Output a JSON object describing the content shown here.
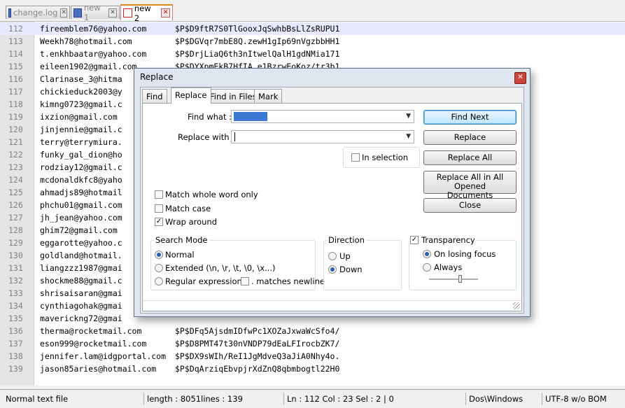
{
  "tabs": [
    {
      "label": "change.log",
      "icon": "file-saved-icon"
    },
    {
      "label": "new  1",
      "icon": "file-saved-icon"
    },
    {
      "label": "new  2",
      "icon": "file-unsaved-icon",
      "active": true
    }
  ],
  "lines": [
    {
      "n": "112",
      "email": "fireemblem76@yahoo.com",
      "pw": "$P$D9ftR7S0TlGooxJqSwhbBsLlZsRUPU1"
    },
    {
      "n": "113",
      "email": "Weekh78@hotmail.com",
      "pw": "$P$DGVqr7mbE8Q.zewH1gIp69nVgzbbHH1"
    },
    {
      "n": "114",
      "email": "t.enkhbaatar@yahoo.com",
      "pw": "$P$DrjLiaQ6th3nItwelQalH1gdNMia171"
    },
    {
      "n": "115",
      "email": "eileen1902@gmail.com",
      "pw": "$P$DYXpmEkB7HfIA.e1BzrwEoKoz/tr3b1"
    },
    {
      "n": "116",
      "email": "Clarinase_3@hitma",
      "pw": ""
    },
    {
      "n": "117",
      "email": "chickieduck2003@y",
      "pw": ""
    },
    {
      "n": "118",
      "email": "kimng0723@gmail.c",
      "pw": ""
    },
    {
      "n": "119",
      "email": "ixzion@gmail.com",
      "pw": ""
    },
    {
      "n": "120",
      "email": "jinjennie@gmail.c",
      "pw": ""
    },
    {
      "n": "121",
      "email": "terry@terrymiura.",
      "pw": ""
    },
    {
      "n": "122",
      "email": "funky_gal_dion@ho",
      "pw": ""
    },
    {
      "n": "123",
      "email": "rodziay12@gmail.c",
      "pw": ""
    },
    {
      "n": "124",
      "email": "mcdonaldkfc8@yaho",
      "pw": ""
    },
    {
      "n": "125",
      "email": "ahmadjs89@hotmail",
      "pw": ""
    },
    {
      "n": "126",
      "email": "phchu01@gmail.com",
      "pw": ""
    },
    {
      "n": "127",
      "email": "jh_jean@yahoo.com",
      "pw": ""
    },
    {
      "n": "128",
      "email": "ghim72@gmail.com",
      "pw": ""
    },
    {
      "n": "129",
      "email": "eggarotte@yahoo.c",
      "pw": ""
    },
    {
      "n": "130",
      "email": "goldland@hotmail.",
      "pw": ""
    },
    {
      "n": "131",
      "email": "liangzzz1987@gmai",
      "pw": ""
    },
    {
      "n": "132",
      "email": "shockme88@gmail.c",
      "pw": ""
    },
    {
      "n": "133",
      "email": "shrisaisaran@gmai",
      "pw": ""
    },
    {
      "n": "134",
      "email": "cynthiagohak@gmai",
      "pw": ""
    },
    {
      "n": "135",
      "email": "maverickng72@gmai",
      "pw": ""
    },
    {
      "n": "136",
      "email": "therma@rocketmail.com",
      "pw": "$P$DFq5AjsdmIDfwPc1XOZaJxwaWcSfo4/"
    },
    {
      "n": "137",
      "email": "eson999@rocketmail.com",
      "pw": "$P$D8PMT47t30nVNDP79dEaLFIrocbZK7/"
    },
    {
      "n": "138",
      "email": "jennifer.lam@idgportal.com",
      "pw": "$P$DX9sWIh/ReI1JgMdveQ3aJiA0Nhy4o."
    },
    {
      "n": "139",
      "email": "jason85aries@hotmail.com",
      "pw": "$P$DqArziqEbvpjrXdZnQ8qbmbogtl22H0"
    }
  ],
  "dialog": {
    "title": "Replace",
    "tabs": [
      "Find",
      "Replace",
      "Find in Files",
      "Mark"
    ],
    "find_label": "Find what :",
    "find_value": "",
    "replace_label": "Replace with :",
    "replace_value": "",
    "in_selection": "In selection",
    "buttons": {
      "find_next": "Find Next",
      "replace": "Replace",
      "replace_all": "Replace All",
      "replace_all_opened_1": "Replace All in All Opened",
      "replace_all_opened_2": "Documents",
      "close": "Close"
    },
    "options": {
      "match_whole_word": "Match whole word only",
      "match_case": "Match case",
      "wrap_around": "Wrap around"
    },
    "search_mode": {
      "title": "Search Mode",
      "normal": "Normal",
      "extended": "Extended (\\n, \\r, \\t, \\0, \\x...)",
      "regex": "Regular expression",
      "matches_newline": ". matches newline"
    },
    "direction": {
      "title": "Direction",
      "up": "Up",
      "down": "Down"
    },
    "transparency": {
      "title": "Transparency",
      "on_losing_focus": "On losing focus",
      "always": "Always",
      "level": 0.65
    }
  },
  "status": {
    "type": "Normal text file",
    "length": "length : 8051",
    "lines": "lines : 139",
    "position": "Ln : 112   Col : 23   Sel : 2 | 0",
    "eol": "Dos\\Windows",
    "encoding": "UTF-8 w/o BOM"
  }
}
